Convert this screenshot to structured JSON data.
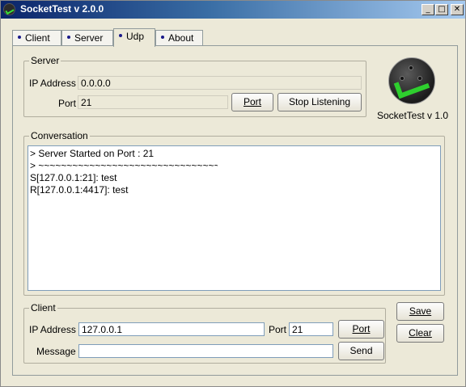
{
  "window": {
    "title": "SocketTest v 2.0.0",
    "min": "_",
    "max": "□",
    "close": "✕"
  },
  "tabs": [
    {
      "label": "Client"
    },
    {
      "label": "Server"
    },
    {
      "label": "Udp"
    },
    {
      "label": "About"
    }
  ],
  "active_tab": "Udp",
  "server": {
    "legend": "Server",
    "ip_label": "IP Address",
    "ip_value": "0.0.0.0",
    "port_label": "Port",
    "port_value": "21",
    "port_button": "Port",
    "stop_button": "Stop Listening"
  },
  "logo": {
    "caption": "SocketTest v 1.0",
    "icon": "socket-check-icon"
  },
  "conversation": {
    "legend": "Conversation",
    "lines": [
      "> Server Started on Port : 21",
      "> ~~~~~~~~~~~~~~~~~~~~~~~~~~~~~~~~",
      "S[127.0.0.1:21]: test",
      "R[127.0.0.1:4417]: test"
    ]
  },
  "client": {
    "legend": "Client",
    "ip_label": "IP Address",
    "ip_value": "127.0.0.1",
    "port_label": "Port",
    "port_value": "21",
    "port_button": "Port",
    "message_label": "Message",
    "message_value": "",
    "send_button": "Send"
  },
  "side_buttons": {
    "save": "Save",
    "clear": "Clear"
  }
}
